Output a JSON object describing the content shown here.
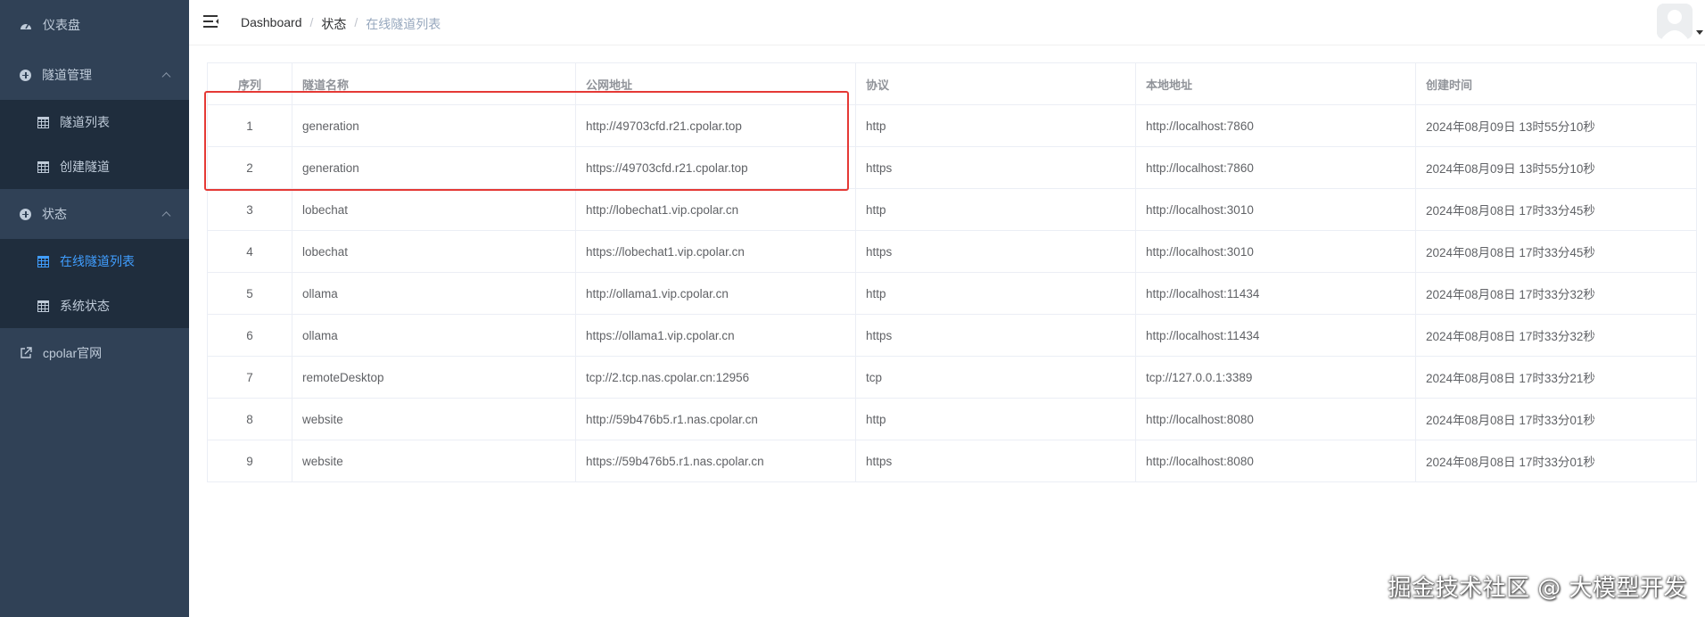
{
  "sidebar": {
    "dashboard": "仪表盘",
    "tunnel_mgmt": {
      "label": "隧道管理",
      "items": [
        "隧道列表",
        "创建隧道"
      ]
    },
    "status": {
      "label": "状态",
      "items": [
        "在线隧道列表",
        "系统状态"
      ],
      "active_index": 0
    },
    "website": "cpolar官网"
  },
  "breadcrumb": [
    "Dashboard",
    "状态",
    "在线隧道列表"
  ],
  "table": {
    "headers": [
      "序列",
      "隧道名称",
      "公网地址",
      "协议",
      "本地地址",
      "创建时间"
    ],
    "rows": [
      [
        "1",
        "generation",
        "http://49703cfd.r21.cpolar.top",
        "http",
        "http://localhost:7860",
        "2024年08月09日 13时55分10秒"
      ],
      [
        "2",
        "generation",
        "https://49703cfd.r21.cpolar.top",
        "https",
        "http://localhost:7860",
        "2024年08月09日 13时55分10秒"
      ],
      [
        "3",
        "lobechat",
        "http://lobechat1.vip.cpolar.cn",
        "http",
        "http://localhost:3010",
        "2024年08月08日 17时33分45秒"
      ],
      [
        "4",
        "lobechat",
        "https://lobechat1.vip.cpolar.cn",
        "https",
        "http://localhost:3010",
        "2024年08月08日 17时33分45秒"
      ],
      [
        "5",
        "ollama",
        "http://ollama1.vip.cpolar.cn",
        "http",
        "http://localhost:11434",
        "2024年08月08日 17时33分32秒"
      ],
      [
        "6",
        "ollama",
        "https://ollama1.vip.cpolar.cn",
        "https",
        "http://localhost:11434",
        "2024年08月08日 17时33分32秒"
      ],
      [
        "7",
        "remoteDesktop",
        "tcp://2.tcp.nas.cpolar.cn:12956",
        "tcp",
        "tcp://127.0.0.1:3389",
        "2024年08月08日 17时33分21秒"
      ],
      [
        "8",
        "website",
        "http://59b476b5.r1.nas.cpolar.cn",
        "http",
        "http://localhost:8080",
        "2024年08月08日 17时33分01秒"
      ],
      [
        "9",
        "website",
        "https://59b476b5.r1.nas.cpolar.cn",
        "https",
        "http://localhost:8080",
        "2024年08月08日 17时33分01秒"
      ]
    ]
  },
  "watermark": "掘金技术社区 @ 大模型开发",
  "colors": {
    "sidebar_bg": "#304156",
    "submenu_bg": "#1f2d3d",
    "active": "#409eff",
    "highlight_box": "#e53935"
  },
  "icons": {
    "dashboard": "gauge-icon",
    "group": "plus-circle-icon",
    "item": "table-icon",
    "external": "external-link-icon",
    "menu": "hamburger-icon"
  }
}
